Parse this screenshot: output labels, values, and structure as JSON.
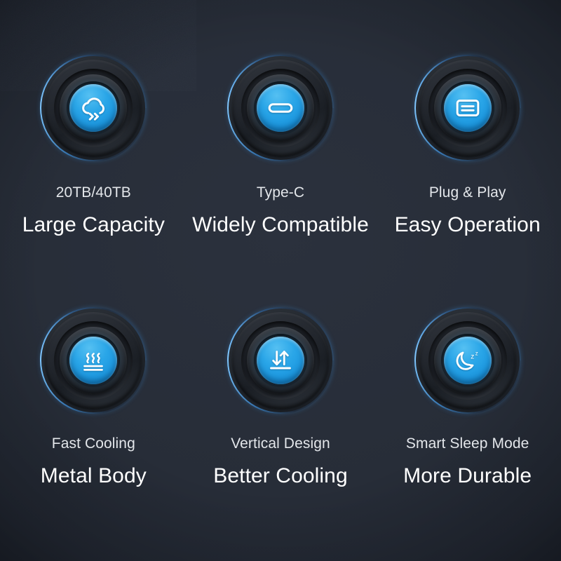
{
  "panel": {
    "background_color": "#272d38",
    "accent_color": "#2aa6e8",
    "rim_highlight_color": "#82c8ff",
    "title_color": "#ffffff",
    "subtitle_color": "#e3e6ea"
  },
  "features": [
    {
      "icon": "cloud-transfer-icon",
      "subtitle": "20TB/40TB",
      "title": "Large Capacity"
    },
    {
      "icon": "usb-type-c-icon",
      "subtitle": "Type-C",
      "title": "Widely Compatible"
    },
    {
      "icon": "plug-and-play-card-icon",
      "subtitle": "Plug & Play",
      "title": "Easy Operation"
    },
    {
      "icon": "heat-dissipation-icon",
      "subtitle": "Fast Cooling",
      "title": "Metal Body"
    },
    {
      "icon": "vertical-airflow-arrows-icon",
      "subtitle": "Vertical Design",
      "title": "Better Cooling"
    },
    {
      "icon": "moon-sleep-icon",
      "subtitle": "Smart Sleep Mode",
      "title": "More Durable"
    }
  ]
}
